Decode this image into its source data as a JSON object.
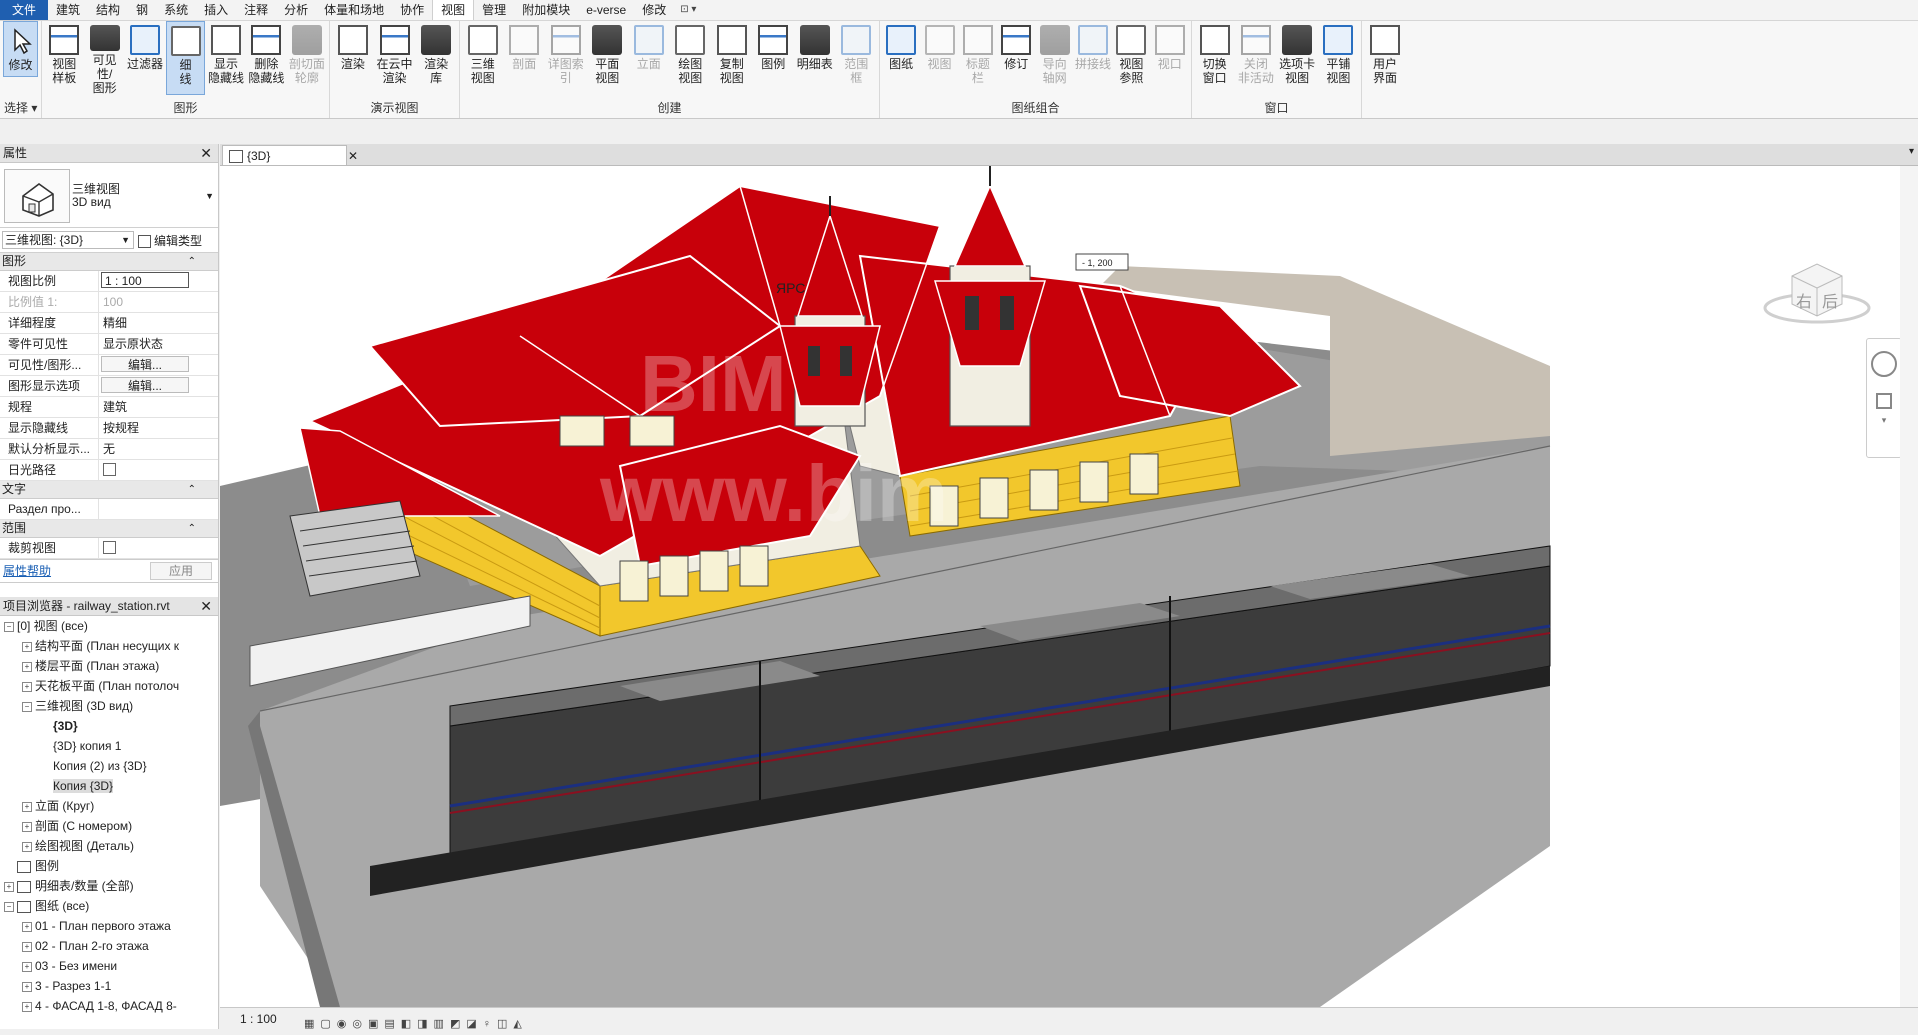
{
  "menu": {
    "tabs": [
      "文件",
      "建筑",
      "结构",
      "钢",
      "系统",
      "插入",
      "注释",
      "分析",
      "体量和场地",
      "协作",
      "视图",
      "管理",
      "附加模块",
      "e-verse",
      "修改",
      "⊡ ▾"
    ],
    "active_index": 10
  },
  "ribbon": {
    "select_group": {
      "modify_label": "修改",
      "select_label": "选择 ▾"
    },
    "graphics": {
      "label": "图形",
      "buttons": [
        "视图\n样板",
        "可见性/\n图形",
        "过滤器",
        "细\n线",
        "显示\n隐藏线",
        "删除\n隐藏线",
        "剖切面\n轮廓"
      ]
    },
    "presentation": {
      "label": "演示视图",
      "buttons": [
        "渲染",
        "在云中\n渲染",
        "渲染\n库"
      ]
    },
    "create": {
      "label": "创建",
      "buttons": [
        "三维\n视图",
        "剖面",
        "详图索引",
        "平面\n视图",
        "立面",
        "绘图\n视图",
        "复制\n视图",
        "图例",
        "明细表",
        "范围\n框"
      ]
    },
    "sheet": {
      "label": "图纸组合",
      "buttons": [
        "图纸",
        "视图",
        "标题\n栏",
        "修订",
        "导向\n轴网",
        "拼接线",
        "视图\n参照",
        "视口"
      ]
    },
    "windows": {
      "label": "窗口",
      "buttons": [
        "切换\n窗口",
        "关闭\n非活动",
        "选项卡\n视图",
        "平铺\n视图"
      ]
    },
    "ui": {
      "buttons": [
        "用户\n界面"
      ]
    }
  },
  "properties": {
    "title": "属性",
    "type_name": "三维视图",
    "type_sub": "3D вид",
    "instance": "三维视图: {3D}",
    "edit_type": "编辑类型",
    "sections": {
      "graphics": "图形",
      "text": "文字",
      "extents": "范围"
    },
    "rows": [
      {
        "k": "视图比例",
        "v": "1 : 100",
        "kind": "box"
      },
      {
        "k": "比例值 1:",
        "v": "100",
        "kind": "dim"
      },
      {
        "k": "详细程度",
        "v": "精细"
      },
      {
        "k": "零件可见性",
        "v": "显示原状态"
      },
      {
        "k": "可见性/图形...",
        "v": "编辑...",
        "kind": "btn"
      },
      {
        "k": "图形显示选项",
        "v": "编辑...",
        "kind": "btn"
      },
      {
        "k": "规程",
        "v": "建筑"
      },
      {
        "k": "显示隐藏线",
        "v": "按规程"
      },
      {
        "k": "默认分析显示...",
        "v": "无"
      },
      {
        "k": "日光路径",
        "v": "",
        "kind": "cb"
      }
    ],
    "text_rows": [
      {
        "k": "Раздел про...",
        "v": ""
      }
    ],
    "extent_rows": [
      {
        "k": "裁剪视图",
        "v": "",
        "kind": "cb"
      }
    ],
    "help": "属性帮助",
    "apply": "应用"
  },
  "browser": {
    "title": "项目浏览器 - railway_station.rvt",
    "items": [
      {
        "t": "[0] 视图 (все)",
        "lvl": 0,
        "tog": "−"
      },
      {
        "t": "结构平面 (План несущих к",
        "lvl": 1,
        "tog": "+"
      },
      {
        "t": "楼层平面 (План этажа)",
        "lvl": 1,
        "tog": "+"
      },
      {
        "t": "天花板平面 (План потолоч",
        "lvl": 1,
        "tog": "+"
      },
      {
        "t": "三维视图 (3D вид)",
        "lvl": 1,
        "tog": "−"
      },
      {
        "t": "{3D}",
        "lvl": 2,
        "bold": true
      },
      {
        "t": "{3D} копия 1",
        "lvl": 2
      },
      {
        "t": "Копия (2) из {3D}",
        "lvl": 2
      },
      {
        "t": "Копия {3D}",
        "lvl": 2,
        "sel": true
      },
      {
        "t": "立面 (Круг)",
        "lvl": 1,
        "tog": "+"
      },
      {
        "t": "剖面 (С номером)",
        "lvl": 1,
        "tog": "+"
      },
      {
        "t": "绘图视图 (Деталь)",
        "lvl": 1,
        "tog": "+"
      },
      {
        "t": "图例",
        "lvl": 0,
        "icon": true
      },
      {
        "t": "明细表/数量 (全部)",
        "lvl": 0,
        "tog": "+",
        "icon": true
      },
      {
        "t": "图纸 (все)",
        "lvl": 0,
        "tog": "−",
        "icon": true
      },
      {
        "t": "01 - План первого этажа",
        "lvl": 1,
        "tog": "+"
      },
      {
        "t": "02 - План 2-го этажа",
        "lvl": 1,
        "tog": "+"
      },
      {
        "t": "03 - Без имени",
        "lvl": 1,
        "tog": "+"
      },
      {
        "t": "3 - Разрез 1-1",
        "lvl": 1,
        "tog": "+"
      },
      {
        "t": "4 - ФАСАД 1-8, ФАСАД 8-",
        "lvl": 1,
        "tog": "+"
      }
    ]
  },
  "view": {
    "tab": "{3D}",
    "building_sign": "ЯРС",
    "level_tag": "- 1, 200",
    "watermark1": "BIM",
    "watermark2": "www.bim",
    "cube_right": "右",
    "cube_back": "后",
    "status_scale": "1 : 100"
  },
  "colors": {
    "roof": "#c8000a",
    "wall_yellow": "#f2c72c",
    "wall_white": "#f1eee2",
    "ground": "#a9a9a9",
    "accent": "#1f5fb0"
  }
}
